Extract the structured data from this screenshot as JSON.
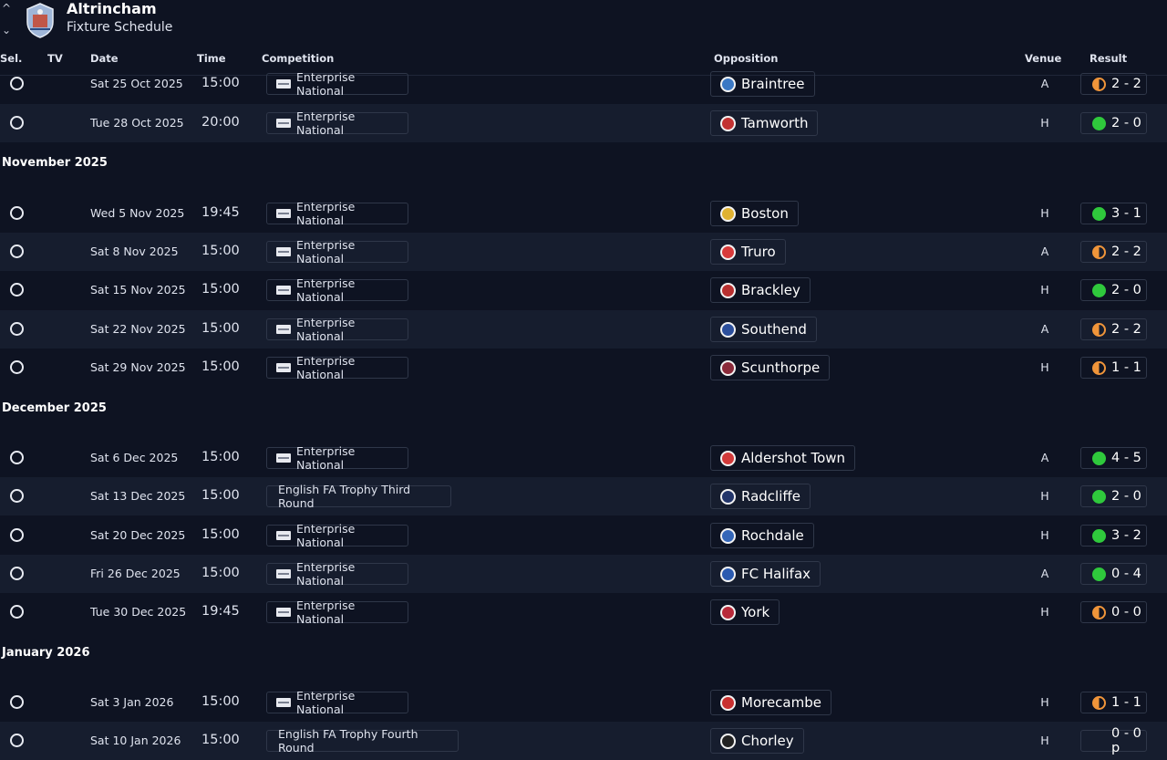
{
  "header": {
    "club_name": "Altrincham",
    "page_title": "Fixture Schedule",
    "up_glyph": "^",
    "down_glyph": "⌄"
  },
  "columns": {
    "sel": "Sel.",
    "tv": "TV",
    "date": "Date",
    "time": "Time",
    "competition": "Competition",
    "opposition": "Opposition",
    "venue": "Venue",
    "result": "Result"
  },
  "months": [
    "November 2025",
    "December 2025",
    "January 2026"
  ],
  "colors": {
    "background": "#0e1322",
    "row_alt": "#161d2e",
    "win": "#2fc93c",
    "draw": "#f0953a",
    "pending": "#e84a4a"
  },
  "fixtures": [
    {
      "date": "Sat 25 Oct 2025",
      "time": "15:00",
      "competition": "Enterprise National",
      "opposition": "Braintree",
      "venue": "A",
      "result": "2 - 2",
      "outcome": "draw",
      "crest_color": "#3b78c4"
    },
    {
      "date": "Tue 28 Oct 2025",
      "time": "20:00",
      "competition": "Enterprise National",
      "opposition": "Tamworth",
      "venue": "H",
      "result": "2 - 0",
      "outcome": "win",
      "crest_color": "#c23232"
    },
    {
      "date": "Wed 5 Nov 2025",
      "time": "19:45",
      "competition": "Enterprise National",
      "opposition": "Boston",
      "venue": "H",
      "result": "3 - 1",
      "outcome": "win",
      "crest_color": "#e0b232"
    },
    {
      "date": "Sat 8 Nov 2025",
      "time": "15:00",
      "competition": "Enterprise National",
      "opposition": "Truro",
      "venue": "A",
      "result": "2 - 2",
      "outcome": "draw",
      "crest_color": "#d83a3a"
    },
    {
      "date": "Sat 15 Nov 2025",
      "time": "15:00",
      "competition": "Enterprise National",
      "opposition": "Brackley",
      "venue": "H",
      "result": "2 - 0",
      "outcome": "win",
      "crest_color": "#b83030"
    },
    {
      "date": "Sat 22 Nov 2025",
      "time": "15:00",
      "competition": "Enterprise National",
      "opposition": "Southend",
      "venue": "A",
      "result": "2 - 2",
      "outcome": "draw",
      "crest_color": "#2c4f9c"
    },
    {
      "date": "Sat 29 Nov 2025",
      "time": "15:00",
      "competition": "Enterprise National",
      "opposition": "Scunthorpe",
      "venue": "H",
      "result": "1 - 1",
      "outcome": "draw",
      "crest_color": "#8a2a3a"
    },
    {
      "date": "Sat 6 Dec 2025",
      "time": "15:00",
      "competition": "Enterprise National",
      "opposition": "Aldershot Town",
      "venue": "A",
      "result": "4 - 5",
      "outcome": "win",
      "crest_color": "#d23a3a"
    },
    {
      "date": "Sat 13 Dec 2025",
      "time": "15:00",
      "competition": "English FA Trophy Third Round",
      "opposition": "Radcliffe",
      "venue": "H",
      "result": "2 - 0",
      "outcome": "win",
      "crest_color": "#22356a"
    },
    {
      "date": "Sat 20 Dec 2025",
      "time": "15:00",
      "competition": "Enterprise National",
      "opposition": "Rochdale",
      "venue": "H",
      "result": "3 - 2",
      "outcome": "win",
      "crest_color": "#3466b8"
    },
    {
      "date": "Fri 26 Dec 2025",
      "time": "15:00",
      "competition": "Enterprise National",
      "opposition": "FC Halifax",
      "venue": "A",
      "result": "0 - 4",
      "outcome": "win",
      "crest_color": "#2a5ab0"
    },
    {
      "date": "Tue 30 Dec 2025",
      "time": "19:45",
      "competition": "Enterprise National",
      "opposition": "York",
      "venue": "H",
      "result": "0 - 0",
      "outcome": "draw",
      "crest_color": "#b82a3a"
    },
    {
      "date": "Sat 3 Jan 2026",
      "time": "15:00",
      "competition": "Enterprise National",
      "opposition": "Morecambe",
      "venue": "H",
      "result": "1 - 1",
      "outcome": "draw",
      "crest_color": "#c83030"
    },
    {
      "date": "Sat 10 Jan 2026",
      "time": "15:00",
      "competition": "English FA Trophy Fourth Round",
      "opposition": "Chorley",
      "venue": "H",
      "result": "0 - 0 p",
      "outcome": "pending",
      "crest_color": "#222222"
    }
  ]
}
